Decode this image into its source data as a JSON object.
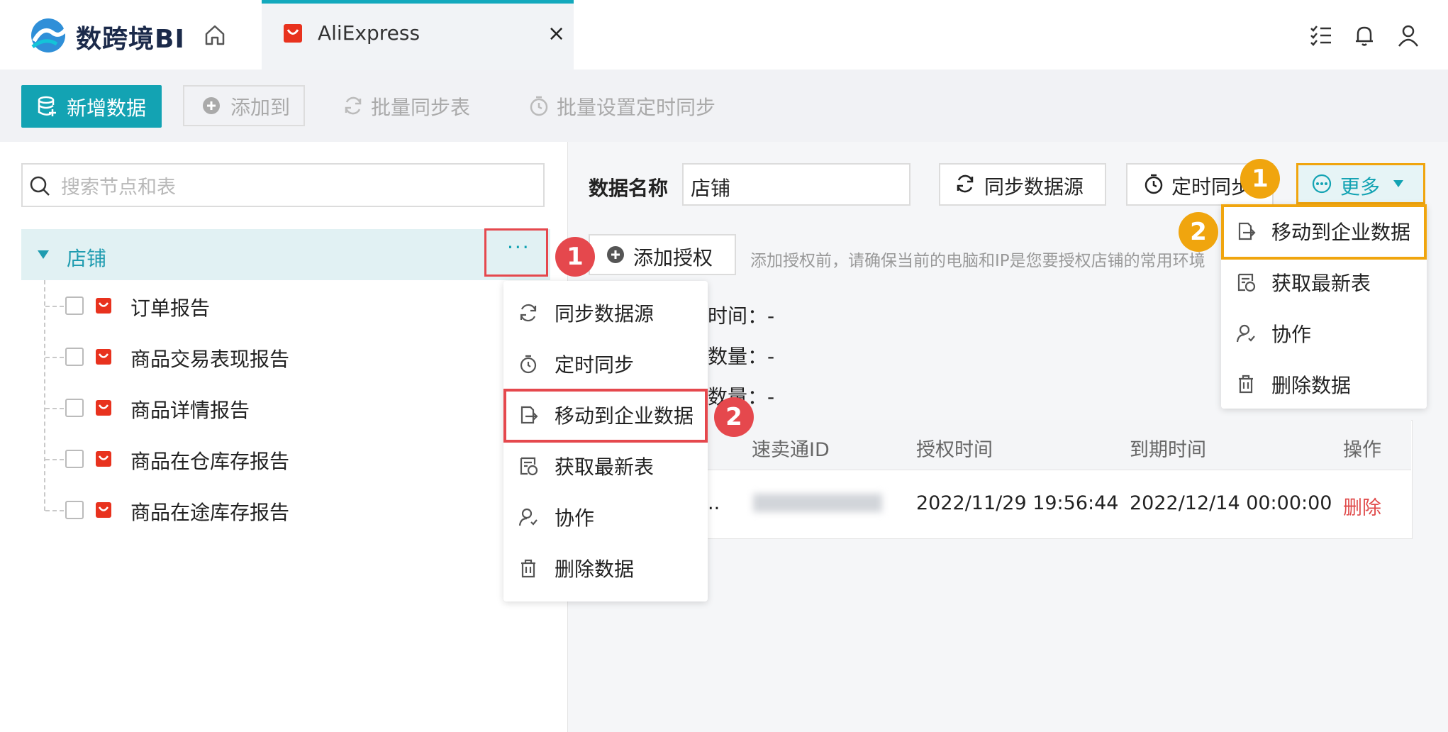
{
  "app": {
    "brand": "数跨境BI"
  },
  "tab": {
    "label": "AliExpress",
    "close": "×"
  },
  "toolbar": {
    "new_data": "新增数据",
    "add_to": "添加到",
    "batch_sync": "批量同步表",
    "batch_timer": "批量设置定时同步"
  },
  "search": {
    "placeholder": "搜索节点和表"
  },
  "tree": {
    "root": "店铺",
    "more": "···",
    "items": [
      "订单报告",
      "商品交易表现报告",
      "商品详情报告",
      "商品在仓库存报告",
      "商品在途库存报告"
    ]
  },
  "context_menu": {
    "items": [
      "同步数据源",
      "定时同步",
      "移动到企业数据",
      "获取最新表",
      "协作",
      "删除数据"
    ]
  },
  "badges": {
    "one": "1",
    "two": "2"
  },
  "detail": {
    "data_name_label": "数据名称",
    "data_name_value": "店铺",
    "sync_source": "同步数据源",
    "timer_sync": "定时同步",
    "more": "更多",
    "add_auth": "添加授权",
    "auth_hint": "添加授权前，请确保当前的电脑和IP是您要授权店铺的常用环境",
    "info_rows": [
      "时间：-",
      "数量：-",
      "数量：-"
    ]
  },
  "table": {
    "headers": [
      "速卖通ID",
      "授权时间",
      "到期时间",
      "操作"
    ],
    "row": {
      "truncated": "..",
      "auth_time": "2022/11/29 19:56:44",
      "expire_time": "2022/12/14 00:00:00",
      "action": "删除"
    }
  },
  "more_menu": {
    "items": [
      "移动到企业数据",
      "获取最新表",
      "协作",
      "删除数据"
    ]
  },
  "colors": {
    "accent": "#13a3b3",
    "highlight_red": "#e5484d",
    "highlight_yellow": "#f0a50e",
    "delete_red": "#e04c4c"
  }
}
